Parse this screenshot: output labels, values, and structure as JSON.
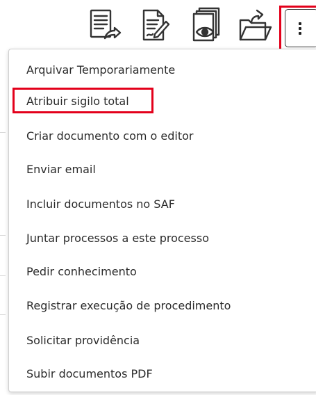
{
  "toolbar": {
    "icons": [
      {
        "name": "document-forward-icon"
      },
      {
        "name": "document-edit-icon"
      },
      {
        "name": "document-view-icon"
      },
      {
        "name": "folder-open-icon"
      },
      {
        "name": "more-options-icon"
      }
    ]
  },
  "menu": {
    "items": [
      {
        "label": "Arquivar Temporariamente"
      },
      {
        "label": "Atribuir sigilo total",
        "highlighted": true
      },
      {
        "label": "Criar documento com o editor"
      },
      {
        "label": "Enviar email"
      },
      {
        "label": "Incluir documentos no SAF"
      },
      {
        "label": "Juntar processos a este processo"
      },
      {
        "label": "Pedir conhecimento"
      },
      {
        "label": "Registrar execução de procedimento"
      },
      {
        "label": "Solicitar providência"
      },
      {
        "label": "Subir documentos PDF"
      }
    ]
  },
  "colors": {
    "highlight": "#e3001b",
    "text": "#2b2b2b",
    "icon_stroke": "#333333"
  }
}
